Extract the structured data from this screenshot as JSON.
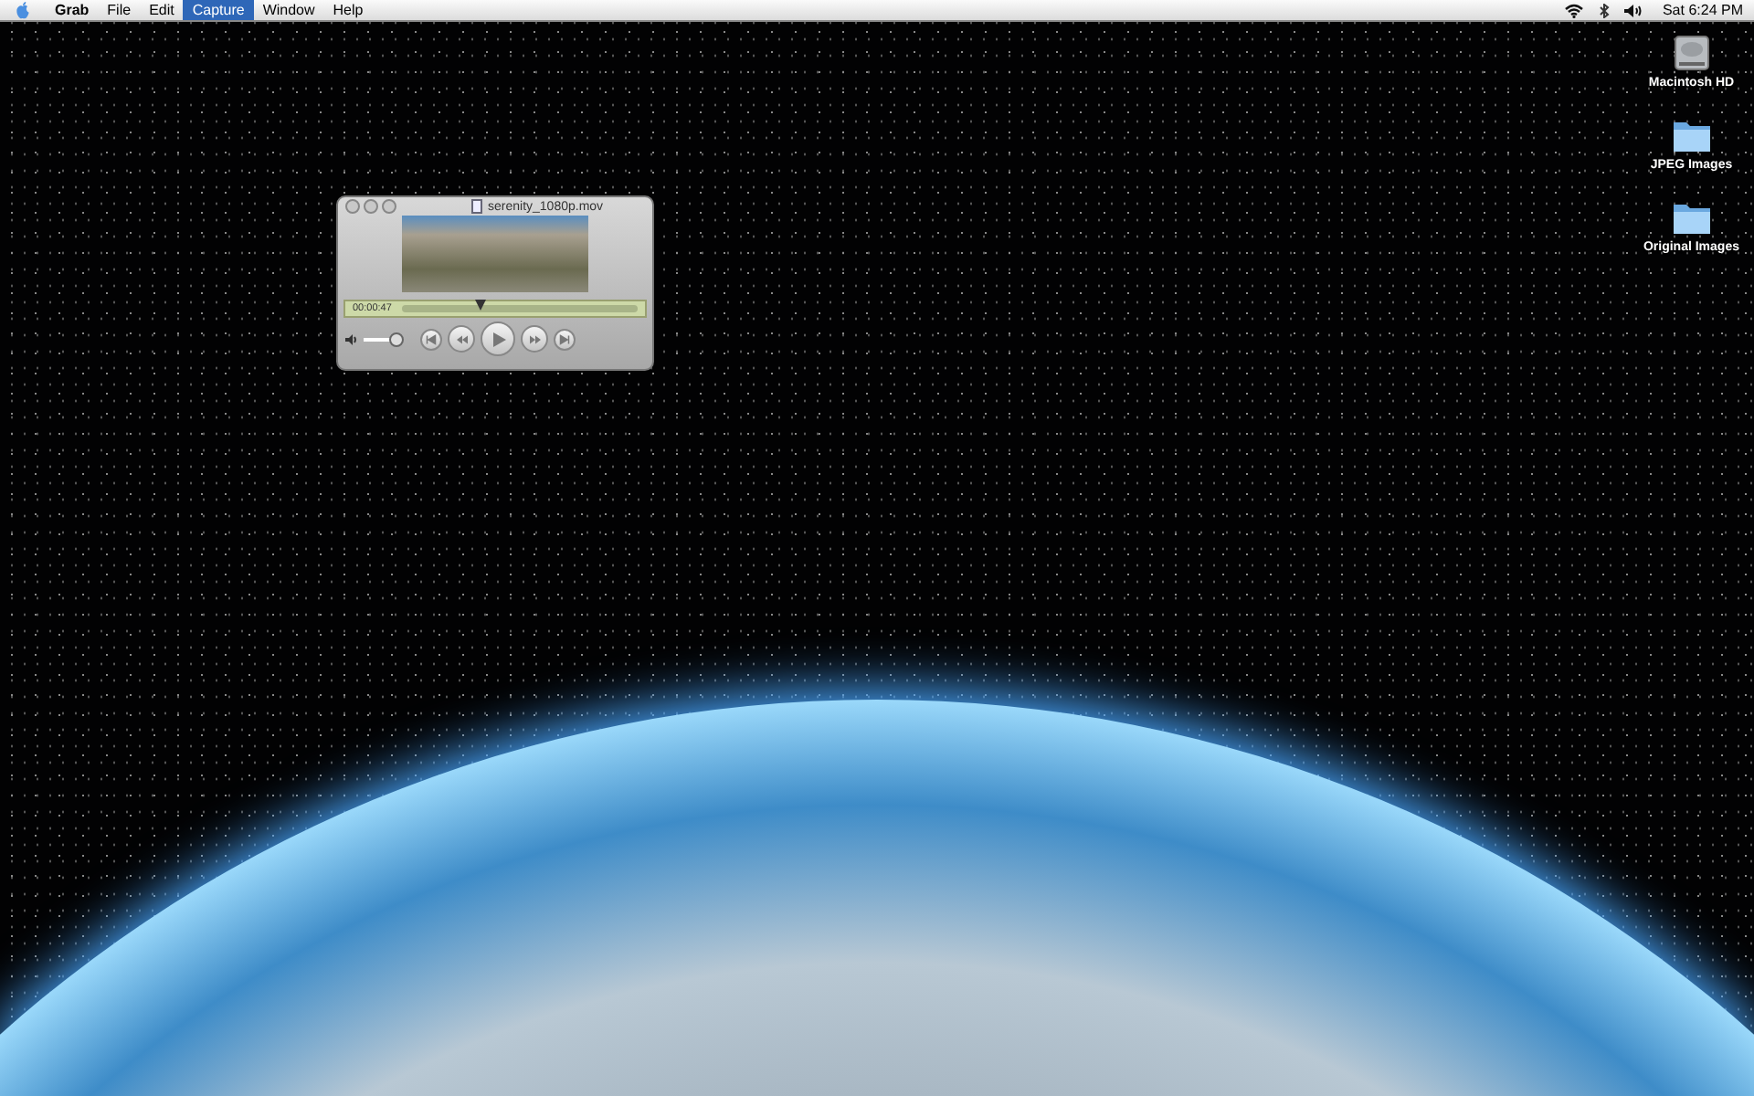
{
  "menu_bar": {
    "items": [
      {
        "label": "Grab",
        "kind": "app",
        "selected": false
      },
      {
        "label": "File",
        "kind": "menu",
        "selected": false
      },
      {
        "label": "Edit",
        "kind": "menu",
        "selected": false
      },
      {
        "label": "Capture",
        "kind": "menu",
        "selected": true
      },
      {
        "label": "Window",
        "kind": "menu",
        "selected": false
      },
      {
        "label": "Help",
        "kind": "menu",
        "selected": false
      }
    ],
    "clock": "Sat 6:24 PM"
  },
  "player_window": {
    "title": "serenity_1080p.mov",
    "timecode": "00:00:47",
    "playhead": {
      "level": 0.33
    },
    "volume": {
      "level": 1.0
    }
  },
  "desktop_icons": [
    {
      "label": "Macintosh HD",
      "kind": "disk"
    },
    {
      "label": "JPEG Images",
      "kind": "folder"
    },
    {
      "label": "Original Images",
      "kind": "folder"
    }
  ]
}
